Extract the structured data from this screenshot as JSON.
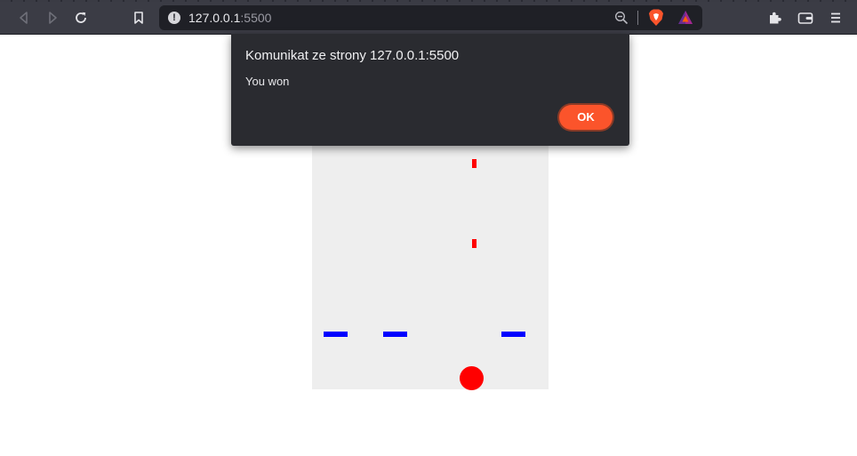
{
  "browser": {
    "url": {
      "host": "127.0.0.1",
      "port": ":5500"
    },
    "icons": {
      "back": "back-arrow-icon",
      "forward": "forward-arrow-icon",
      "reload": "reload-icon",
      "bookmark": "bookmark-icon",
      "site_info": "info-icon",
      "zoom": "zoom-out-icon",
      "shields": "brave-shields-icon",
      "rewards": "brave-rewards-icon",
      "extensions": "puzzle-icon",
      "wallet": "wallet-icon",
      "menu": "hamburger-menu-icon"
    },
    "site_info_glyph": "!"
  },
  "game": {
    "colors": {
      "background": "#eeeeee",
      "bullet": "#ff0000",
      "enemy": "#0000ff",
      "player": "#ff0000"
    }
  },
  "dialog": {
    "title": "Komunikat ze strony 127.0.0.1:5500",
    "message": "You won",
    "ok_label": "OK",
    "accent": "#fb542b"
  }
}
